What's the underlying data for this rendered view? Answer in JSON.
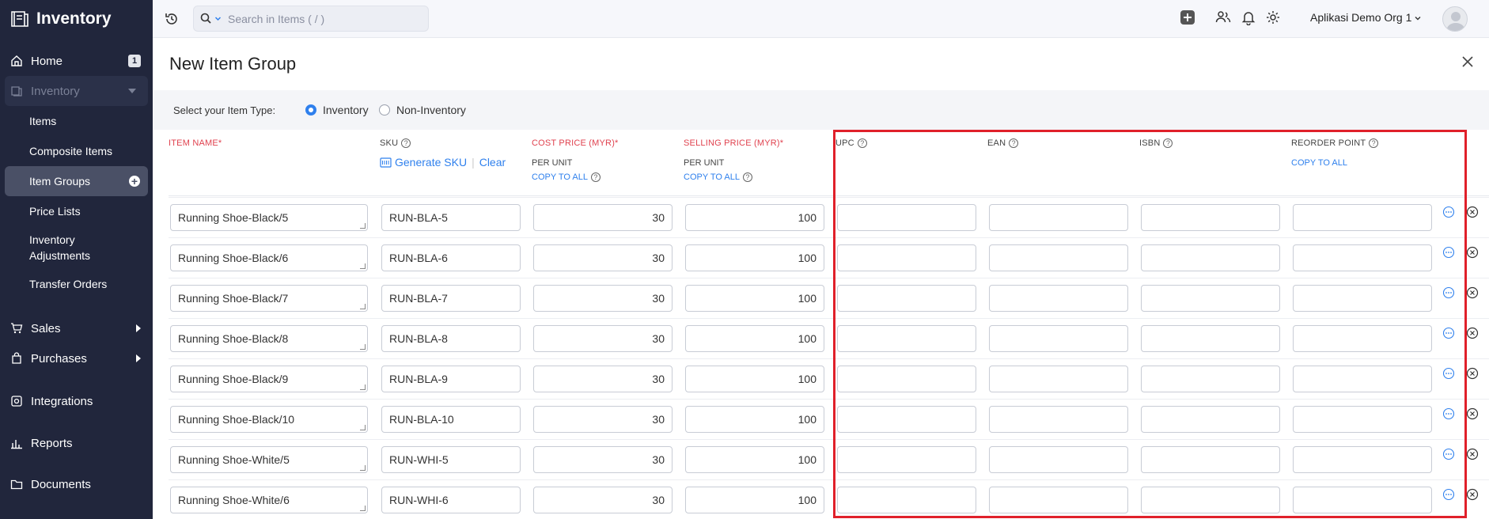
{
  "app": {
    "title": "Inventory"
  },
  "sidebar": {
    "home": {
      "label": "Home",
      "badge": "1"
    },
    "inventory": {
      "label": "Inventory"
    },
    "sub_items": [
      "Items",
      "Composite Items",
      "Item Groups",
      "Price Lists",
      "Inventory Adjustments",
      "Transfer Orders"
    ],
    "sales": {
      "label": "Sales"
    },
    "purchases": {
      "label": "Purchases"
    },
    "integrations": {
      "label": "Integrations"
    },
    "reports": {
      "label": "Reports"
    },
    "documents": {
      "label": "Documents"
    }
  },
  "topbar": {
    "search_placeholder": "Search in Items ( / )",
    "org_name": "Aplikasi Demo Org 1"
  },
  "page": {
    "title": "New Item Group",
    "item_type_label": "Select your Item Type:",
    "type_options": [
      "Inventory",
      "Non-Inventory"
    ],
    "selected_type": "Inventory"
  },
  "columns": {
    "item_name": "ITEM NAME*",
    "sku": "SKU",
    "generate_sku": "Generate SKU",
    "clear": "Clear",
    "cost_price": "COST PRICE (MYR)*",
    "selling_price": "SELLING PRICE (MYR)*",
    "per_unit": "PER UNIT",
    "copy_to_all": "COPY TO ALL",
    "upc": "UPC",
    "ean": "EAN",
    "isbn": "ISBN",
    "reorder_point": "REORDER POINT"
  },
  "rows": [
    {
      "name": "Running Shoe-Black/5",
      "sku": "RUN-BLA-5",
      "cost": "30",
      "selling": "100",
      "upc": "",
      "ean": "",
      "isbn": "",
      "reorder": ""
    },
    {
      "name": "Running Shoe-Black/6",
      "sku": "RUN-BLA-6",
      "cost": "30",
      "selling": "100",
      "upc": "",
      "ean": "",
      "isbn": "",
      "reorder": ""
    },
    {
      "name": "Running Shoe-Black/7",
      "sku": "RUN-BLA-7",
      "cost": "30",
      "selling": "100",
      "upc": "",
      "ean": "",
      "isbn": "",
      "reorder": ""
    },
    {
      "name": "Running Shoe-Black/8",
      "sku": "RUN-BLA-8",
      "cost": "30",
      "selling": "100",
      "upc": "",
      "ean": "",
      "isbn": "",
      "reorder": ""
    },
    {
      "name": "Running Shoe-Black/9",
      "sku": "RUN-BLA-9",
      "cost": "30",
      "selling": "100",
      "upc": "",
      "ean": "",
      "isbn": "",
      "reorder": ""
    },
    {
      "name": "Running Shoe-Black/10",
      "sku": "RUN-BLA-10",
      "cost": "30",
      "selling": "100",
      "upc": "",
      "ean": "",
      "isbn": "",
      "reorder": ""
    },
    {
      "name": "Running Shoe-White/5",
      "sku": "RUN-WHI-5",
      "cost": "30",
      "selling": "100",
      "upc": "",
      "ean": "",
      "isbn": "",
      "reorder": ""
    },
    {
      "name": "Running Shoe-White/6",
      "sku": "RUN-WHI-6",
      "cost": "30",
      "selling": "100",
      "upc": "",
      "ean": "",
      "isbn": "",
      "reorder": ""
    }
  ],
  "colors": {
    "sidebar_bg": "#21263c",
    "accent": "#2f80ed",
    "required": "#e0424f",
    "highlight": "#e0202a"
  }
}
